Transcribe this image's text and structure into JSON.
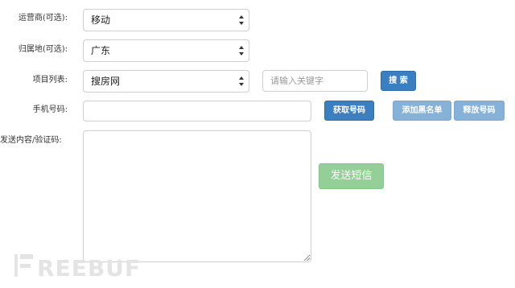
{
  "form": {
    "carrier": {
      "label": "运营商(可选):",
      "value": "移动"
    },
    "region": {
      "label": "归属地(可选):",
      "value": "广东"
    },
    "project": {
      "label": "项目列表:",
      "value": "搜房网",
      "search_placeholder": "请输入关键字",
      "search_button": "搜 索"
    },
    "phone": {
      "label": "手机号码:",
      "value": "",
      "get_button": "获取号码",
      "blacklist_button": "添加黑名单",
      "release_button": "释放号码"
    },
    "content": {
      "label": "发送内容/验证码:",
      "value": "",
      "send_button": "发送短信"
    }
  },
  "watermark": "FREEBUF"
}
